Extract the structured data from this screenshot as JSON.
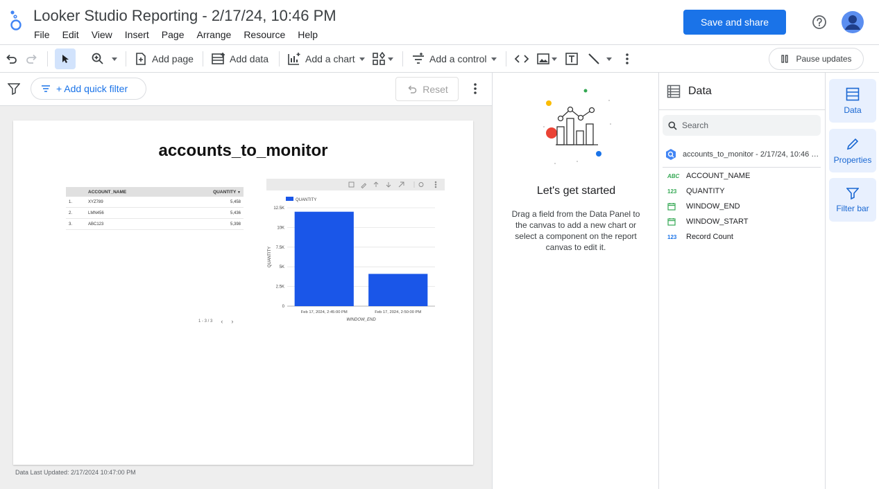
{
  "app": {
    "title": "Looker Studio Reporting - 2/17/24, 10:46 PM",
    "menu": [
      "File",
      "Edit",
      "View",
      "Insert",
      "Page",
      "Arrange",
      "Resource",
      "Help"
    ],
    "save_label": "Save and share"
  },
  "toolbar": {
    "add_page": "Add page",
    "add_data": "Add data",
    "add_chart": "Add a chart",
    "add_control": "Add a control",
    "pause": "Pause updates"
  },
  "filterbar": {
    "quick_filter": "+ Add quick filter",
    "reset": "Reset"
  },
  "report": {
    "title": "accounts_to_monitor",
    "footer": "Data Last Updated: 2/17/2024 10:47:00 PM",
    "table": {
      "headers": [
        "ACCOUNT_NAME",
        "QUANTITY"
      ],
      "rows": [
        {
          "idx": "1.",
          "name": "XYZ789",
          "qty": "5,458"
        },
        {
          "idx": "2.",
          "name": "LMN456",
          "qty": "5,436"
        },
        {
          "idx": "3.",
          "name": "ABC123",
          "qty": "5,398"
        }
      ],
      "pager": "1 - 3 / 3"
    }
  },
  "chart_data": {
    "type": "bar",
    "categories": [
      "Feb 17, 2024, 2:45:00 PM",
      "Feb 17, 2024, 2:50:00 PM"
    ],
    "series": [
      {
        "name": "QUANTITY",
        "values": [
          12000,
          4100
        ],
        "color": "#1a56e8"
      }
    ],
    "xlabel": "WINDOW_END",
    "ylabel": "QUANTITY",
    "ylim": [
      0,
      12500
    ],
    "yticks": [
      "0",
      "2.5K",
      "5K",
      "7.5K",
      "10K",
      "12.5K"
    ],
    "ytick_values": [
      0,
      2500,
      5000,
      7500,
      10000,
      12500
    ],
    "grid": true,
    "legend": "top-left"
  },
  "welcome": {
    "title": "Let's get started",
    "body": "Drag a field from the Data Panel to the canvas to add a new chart or select a component on the report canvas to edit it."
  },
  "data_panel": {
    "title": "Data",
    "search_placeholder": "Search",
    "source": "accounts_to_monitor - 2/17/24, 10:46 …",
    "fields": [
      {
        "type": "ABC",
        "name": "ACCOUNT_NAME",
        "color": "#34a853"
      },
      {
        "type": "123",
        "name": "QUANTITY",
        "color": "#34a853"
      },
      {
        "type": "date",
        "name": "WINDOW_END",
        "color": "#34a853"
      },
      {
        "type": "date",
        "name": "WINDOW_START",
        "color": "#34a853"
      },
      {
        "type": "123",
        "name": "Record Count",
        "color": "#1a73e8"
      }
    ]
  },
  "rail": {
    "data": "Data",
    "properties": "Properties",
    "filter_bar": "Filter bar"
  },
  "colors": {
    "accent": "#1a73e8",
    "bar": "#1a56e8"
  }
}
